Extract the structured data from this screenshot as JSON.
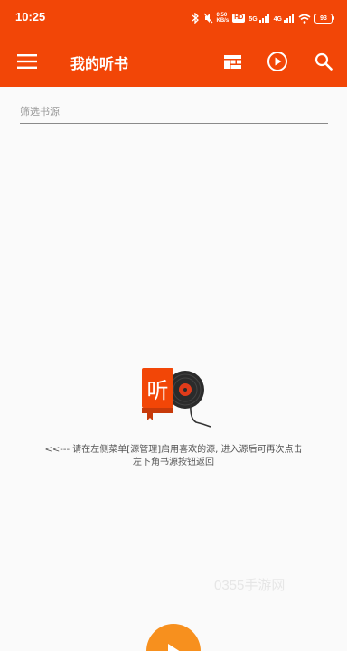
{
  "status_bar": {
    "time": "10:25",
    "network_speed_top": "0.50",
    "network_speed_unit": "KB/s",
    "hd_badge": "HD",
    "signal_5g": "5G",
    "signal_4g": "4G",
    "battery_level": "93"
  },
  "toolbar": {
    "title": "我的听书",
    "menu_icon": "hamburger-menu-icon",
    "actions": [
      {
        "name": "book-source-icon"
      },
      {
        "name": "play-circle-icon"
      },
      {
        "name": "search-icon"
      }
    ],
    "accent_color": "#f24607"
  },
  "filter": {
    "placeholder": "筛选书源"
  },
  "empty_state": {
    "logo_text": "听",
    "message_line1": "<<--- 请在左侧菜单[源管理]启用喜欢的源, 进入源后可再次点击",
    "message_line2": "左下角书源按钮返回"
  },
  "watermark": "0355手游网",
  "fab": {
    "icon": "play-icon",
    "color": "#f7901e"
  }
}
